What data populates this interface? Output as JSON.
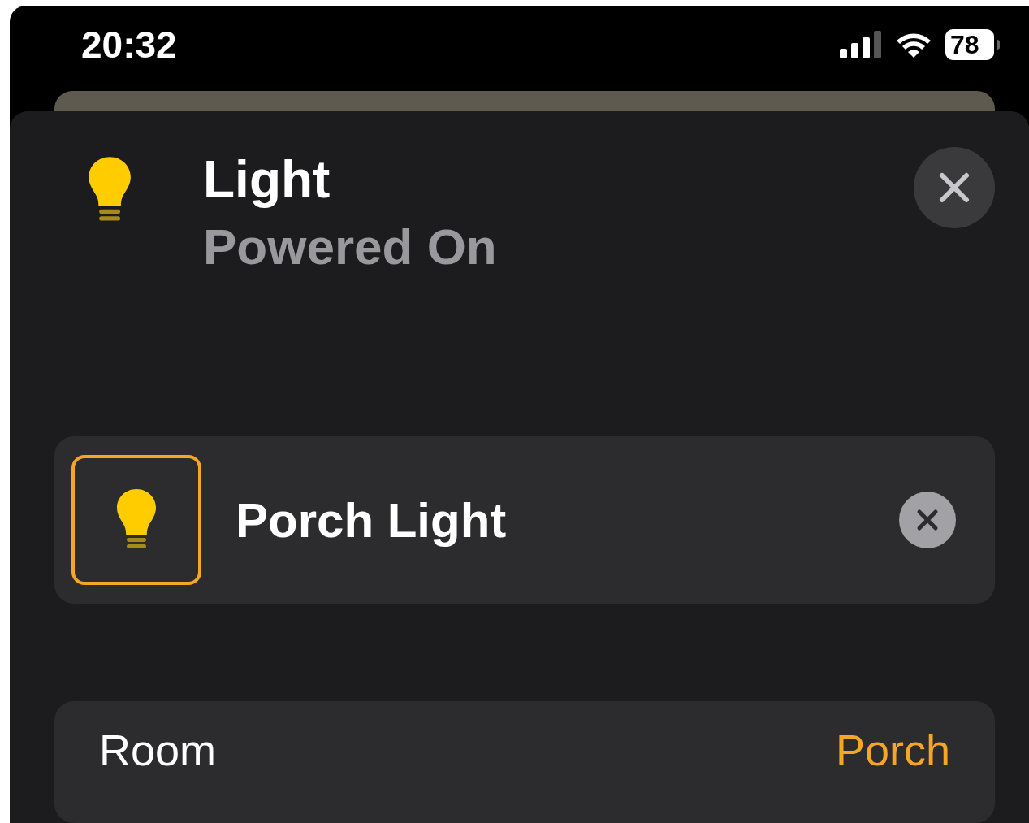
{
  "status_bar": {
    "time": "20:32",
    "battery": "78"
  },
  "header": {
    "title": "Light",
    "subtitle": "Powered On"
  },
  "accessory": {
    "name": "Porch Light"
  },
  "details": [
    {
      "label": "Room",
      "value": "Porch"
    }
  ]
}
